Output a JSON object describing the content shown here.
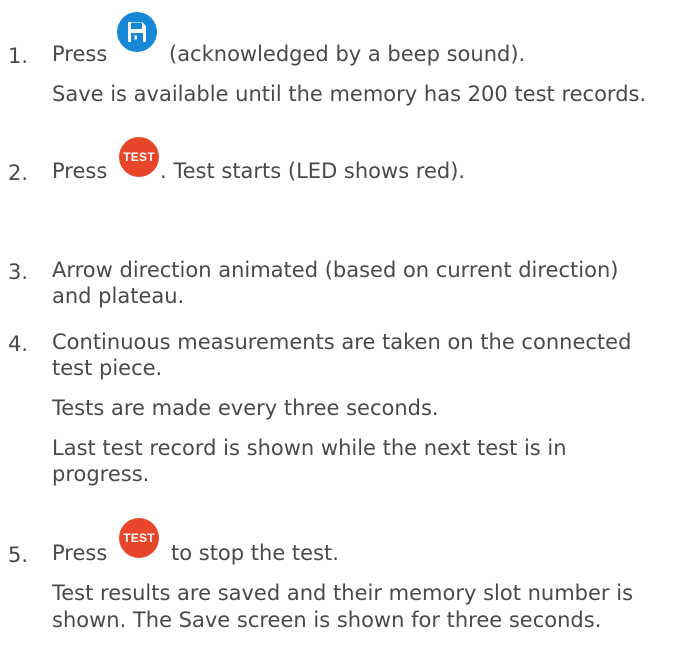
{
  "steps": [
    {
      "number": "1.",
      "press_label": "Press",
      "button_icon": "floppy-disk-icon",
      "after_button": "(acknowledged by a beep sound).",
      "lines": [
        "Save is available until the memory has 200 test records."
      ]
    },
    {
      "number": "2.",
      "press_label": "Press",
      "button_label": "TEST",
      "after_button": ". Test starts (LED shows red)."
    },
    {
      "number": "3.",
      "lines": [
        "Arrow direction animated (based on current direction)",
        "and plateau."
      ]
    },
    {
      "number": "4.",
      "lines": [
        "Continuous measurements are taken on the connected",
        "test piece.",
        "Tests are made every three seconds.",
        "Last test record is shown while the next test is in",
        "progress."
      ]
    },
    {
      "number": "5.",
      "press_label": "Press",
      "button_label": "TEST",
      "after_button": "to stop the test.",
      "lines": [
        "Test results are saved and their memory slot number is",
        "shown. The Save screen is shown for three seconds."
      ]
    }
  ],
  "colors": {
    "text": "#4a4a4a",
    "save_button": "#1788d6",
    "test_button": "#e8462a"
  }
}
